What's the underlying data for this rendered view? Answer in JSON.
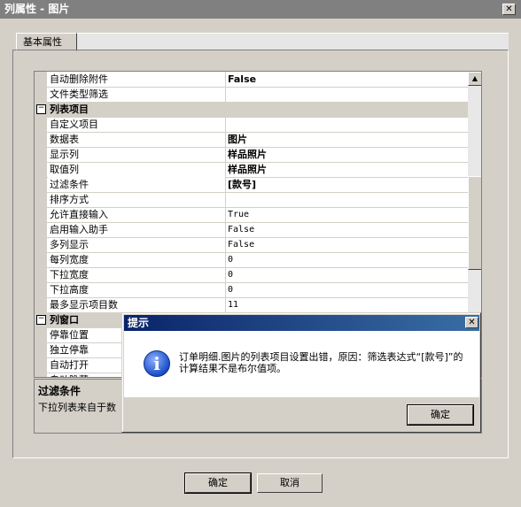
{
  "window": {
    "title": "列属性 - 图片",
    "close_glyph": "✕"
  },
  "tabs": [
    {
      "label": "基本属性"
    }
  ],
  "grid": {
    "rows": [
      {
        "type": "prop",
        "label": "自动删除附件",
        "value": "False",
        "bold": true
      },
      {
        "type": "prop",
        "label": "文件类型筛选",
        "value": ""
      },
      {
        "type": "category",
        "label": "列表项目",
        "expander": "⊟"
      },
      {
        "type": "prop",
        "label": "自定义项目",
        "value": ""
      },
      {
        "type": "prop",
        "label": "数据表",
        "value": "图片",
        "bold": true
      },
      {
        "type": "prop",
        "label": "显示列",
        "value": "样品照片",
        "bold": true
      },
      {
        "type": "prop",
        "label": "取值列",
        "value": "样品照片",
        "bold": true
      },
      {
        "type": "prop",
        "label": "过滤条件",
        "value": "[款号]",
        "bold": true,
        "selected": true
      },
      {
        "type": "prop",
        "label": "排序方式",
        "value": ""
      },
      {
        "type": "prop",
        "label": "允许直接输入",
        "value": "True"
      },
      {
        "type": "prop",
        "label": "启用输入助手",
        "value": "False"
      },
      {
        "type": "prop",
        "label": "多列显示",
        "value": "False"
      },
      {
        "type": "prop",
        "label": "每列宽度",
        "value": "0"
      },
      {
        "type": "prop",
        "label": "下拉宽度",
        "value": "0"
      },
      {
        "type": "prop",
        "label": "下拉高度",
        "value": "0"
      },
      {
        "type": "prop",
        "label": "最多显示项目数",
        "value": "11"
      },
      {
        "type": "category",
        "label": "列窗口",
        "expander": "⊟"
      },
      {
        "type": "prop",
        "label": "停靠位置",
        "value": ""
      },
      {
        "type": "prop",
        "label": "独立停靠",
        "value": ""
      },
      {
        "type": "prop",
        "label": "自动打开",
        "value": ""
      },
      {
        "type": "prop",
        "label": "自动隐藏",
        "value": ""
      }
    ]
  },
  "description": {
    "title": "过滤条件",
    "text": "下拉列表来自于数"
  },
  "buttons": {
    "ok": "确定",
    "cancel": "取消"
  },
  "dialog": {
    "title": "提示",
    "close_glyph": "✕",
    "icon": "info-icon",
    "icon_glyph": "i",
    "message": "订单明细.图片的列表项目设置出错，原因：筛选表达式“[款号]”的计算结果不是布尔值项。",
    "ok": "确定"
  },
  "colors": {
    "dialog_titlebar": "#0a246a",
    "window_titlebar": "#808080"
  }
}
